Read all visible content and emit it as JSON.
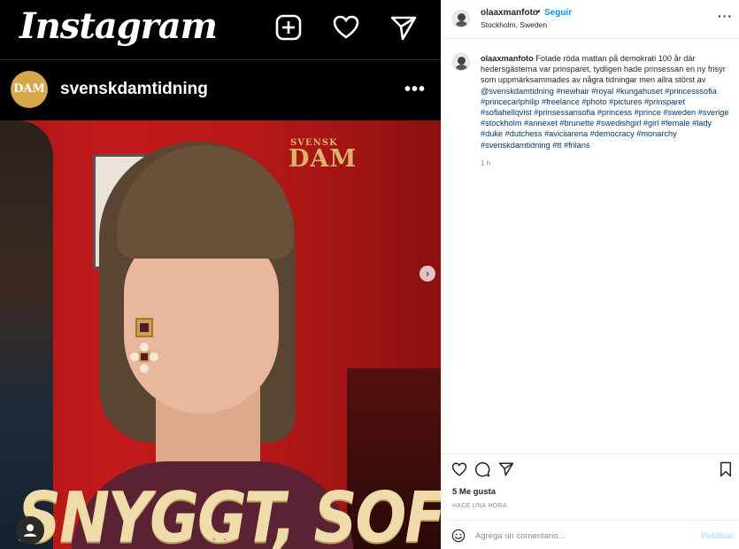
{
  "image_panel": {
    "app_logo": "Instagram",
    "top_icons": [
      "plus-square-icon",
      "heart-icon",
      "send-icon"
    ],
    "account": {
      "name": "svenskdamtidning",
      "avatar_text": "DAM",
      "more_icon": "ellipsis-icon"
    },
    "photo": {
      "brand_small": "SVENSK",
      "brand_large": "DAM",
      "headline": "SNYGGT, SOFIA!"
    },
    "next_icon": "chevron-right-icon",
    "next_glyph": "›",
    "user_icon": "user-icon"
  },
  "post": {
    "username": "olaaxmanfoto",
    "separator": "•",
    "follow_label": "Seguir",
    "location": "Stockholm, Sweden",
    "more_icon": "ellipsis-icon",
    "caption_text": "Fotade röda mattan på demokrati 100 år där hedersgästerna var prinsparet, tydligen hade prinsessan en ny frisyr som uppmärksammades av några tidningar men allra störst av",
    "hashtags": [
      "@svenskdamtidning",
      "#newhair",
      "#royal",
      "#kungahuset",
      "#princesssofia",
      "#princecarlphilip",
      "#freelance",
      "#photo",
      "#pictures",
      "#prinsparet",
      "#sofiahellqvist",
      "#prinsessansofia",
      "#princess",
      "#prince",
      "#sweden",
      "#sverige",
      "#stockholm",
      "#annexet",
      "#brunette",
      "#swedishgirl",
      "#girl",
      "#female",
      "#lady",
      "#duke",
      "#dutchess",
      "#aviciiarena",
      "#democracy",
      "#monarchy",
      "#svenskdamtidning",
      "#tt",
      "#frilans"
    ],
    "caption_time": "1 h",
    "likes": "5 Me gusta",
    "post_time": "HACE UNA HORA",
    "comment_placeholder": "Agrega un comentario...",
    "publish_label": "Publicar"
  }
}
